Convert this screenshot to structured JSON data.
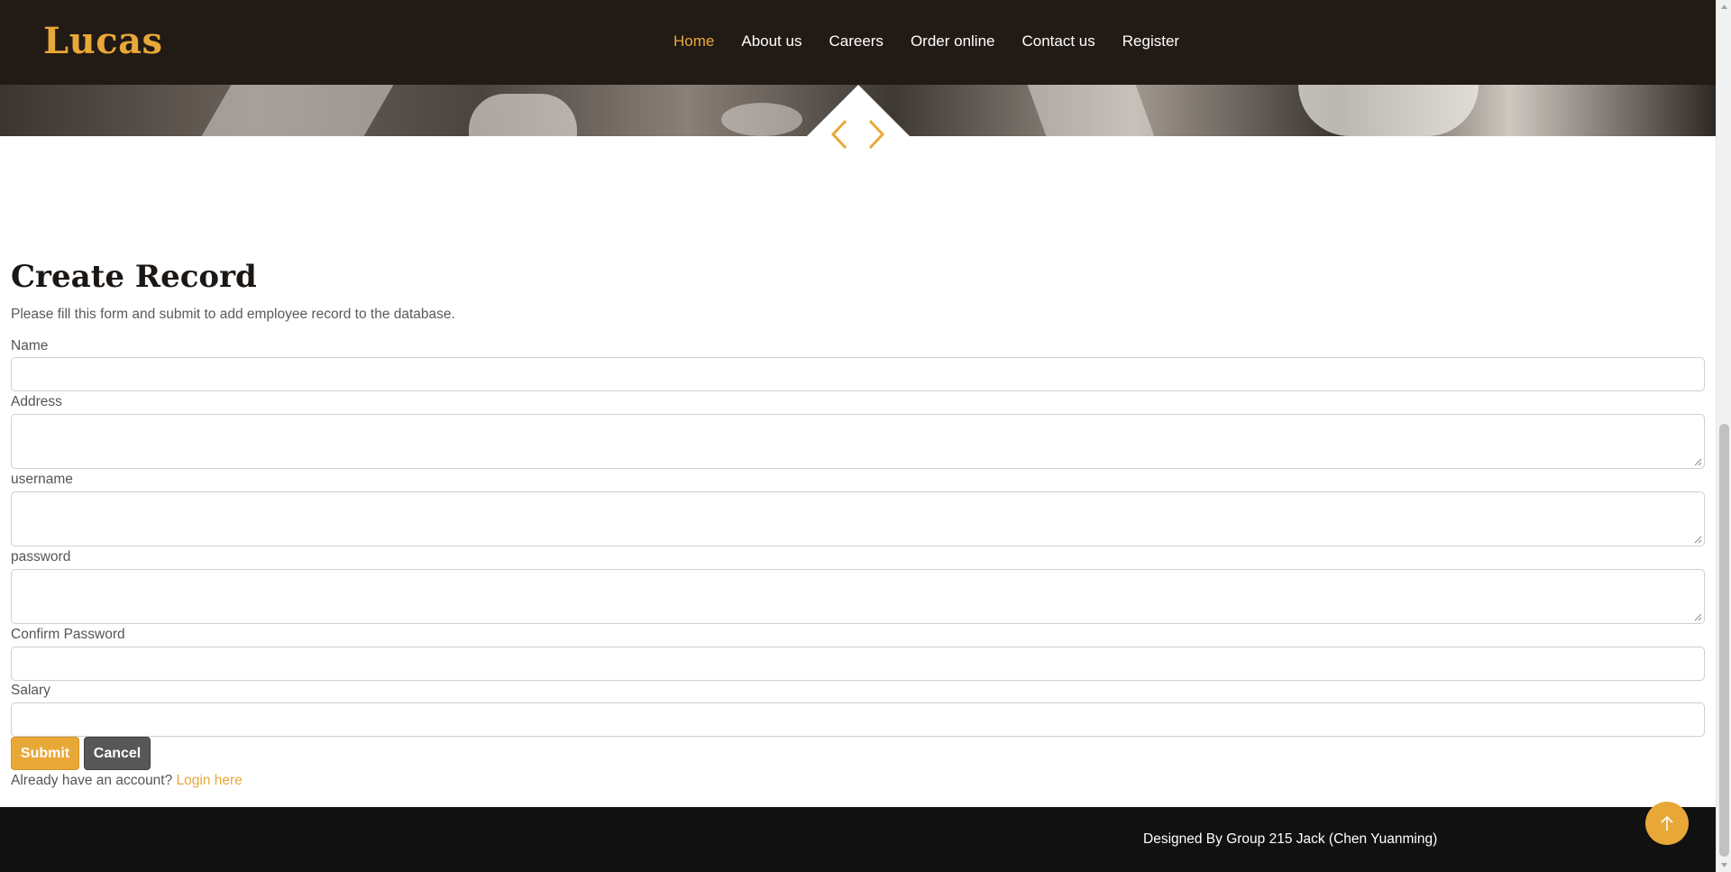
{
  "header": {
    "logo": "Lucas",
    "nav": [
      {
        "label": "Home",
        "active": true
      },
      {
        "label": "About us",
        "active": false
      },
      {
        "label": "Careers",
        "active": false
      },
      {
        "label": "Order online",
        "active": false
      },
      {
        "label": "Contact us",
        "active": false
      },
      {
        "label": "Register",
        "active": false
      }
    ]
  },
  "carousel": {
    "prev_icon": "chevron-left-icon",
    "next_icon": "chevron-right-icon"
  },
  "form": {
    "title": "Create Record",
    "subtitle": "Please fill this form and submit to add employee record to the database.",
    "fields": [
      {
        "label": "Name",
        "value": "",
        "type": "input"
      },
      {
        "label": "Address",
        "value": "",
        "type": "textarea"
      },
      {
        "label": "username",
        "value": "",
        "type": "textarea"
      },
      {
        "label": "password",
        "value": "",
        "type": "textarea"
      },
      {
        "label": "Confirm Password",
        "value": "",
        "type": "input"
      },
      {
        "label": "Salary",
        "value": "",
        "type": "input"
      }
    ],
    "submit_label": "Submit",
    "cancel_label": "Cancel",
    "login_prompt": "Already have an account?",
    "login_link": "Login here"
  },
  "footer": {
    "text": "Designed By Group 215 Jack (Chen Yuanming)",
    "to_top_icon": "arrow-up-icon"
  },
  "colors": {
    "accent": "#e8a838",
    "header_bg": "#221a15",
    "footer_bg": "#111111",
    "cancel_bg": "#575757"
  }
}
